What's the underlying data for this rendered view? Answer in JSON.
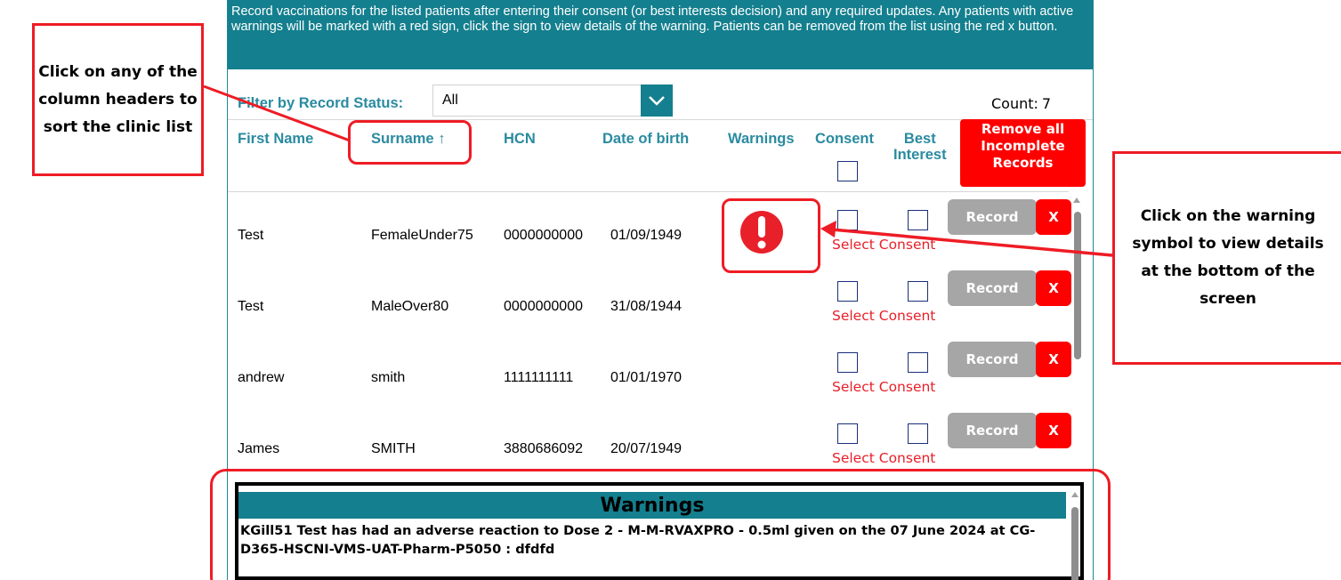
{
  "banner": {
    "text": "Record vaccinations for the listed patients after entering their consent (or best interests decision) and any required updates. Any patients with active warnings will be marked with a red sign, click the sign to view details of the warning. Patients can be removed from the list using the red x button."
  },
  "filter": {
    "label": "Filter by Record Status:",
    "value": "All"
  },
  "count": {
    "label": "Count:",
    "value": "7"
  },
  "columns": {
    "first_name": "First Name",
    "surname": "Surname",
    "surname_sort_icon": "↑",
    "hcn": "HCN",
    "dob": "Date of birth",
    "warnings": "Warnings",
    "consent": "Consent",
    "best_interest_line1": "Best",
    "best_interest_line2": "Interest"
  },
  "remove_all": {
    "line1": "Remove all",
    "line2": "Incomplete",
    "line3": "Records"
  },
  "rows": [
    {
      "first_name": "Test",
      "surname": "FemaleUnder75",
      "hcn": "0000000000",
      "dob": "01/09/1949",
      "has_warning": true,
      "consent_status": "Select Consent",
      "record_label": "Record",
      "remove_label": "X"
    },
    {
      "first_name": "Test",
      "surname": "MaleOver80",
      "hcn": "0000000000",
      "dob": "31/08/1944",
      "has_warning": false,
      "consent_status": "Select Consent",
      "record_label": "Record",
      "remove_label": "X"
    },
    {
      "first_name": "andrew",
      "surname": "smith",
      "hcn": "1111111111",
      "dob": "01/01/1970",
      "has_warning": false,
      "consent_status": "Select Consent",
      "record_label": "Record",
      "remove_label": "X"
    },
    {
      "first_name": "James",
      "surname": "SMITH",
      "hcn": "3880686092",
      "dob": "20/07/1949",
      "has_warning": false,
      "consent_status": "Select Consent",
      "record_label": "Record",
      "remove_label": "X"
    }
  ],
  "warnings_panel": {
    "title": "Warnings",
    "text": "KGill51 Test has had an adverse reaction to Dose 2 - M-M-RVAXPRO - 0.5ml given on the 07 June 2024 at CG-D365-HSCNI-VMS-UAT-Pharm-P5050 : dfdfd"
  },
  "annotations": {
    "left_callout": "Click on any of the column headers to sort the clinic list",
    "right_callout": "Click on the warning symbol to view details at the bottom of the screen"
  },
  "colors": {
    "teal": "#147f8e",
    "header_text": "#2a8ba0",
    "red": "#ff0000",
    "annotation_red": "#ee1c25",
    "record_grey": "#a6a6a6"
  },
  "icons": {
    "filter_dropdown": "chevron-down-icon",
    "warning": "exclamation-circle-icon"
  }
}
